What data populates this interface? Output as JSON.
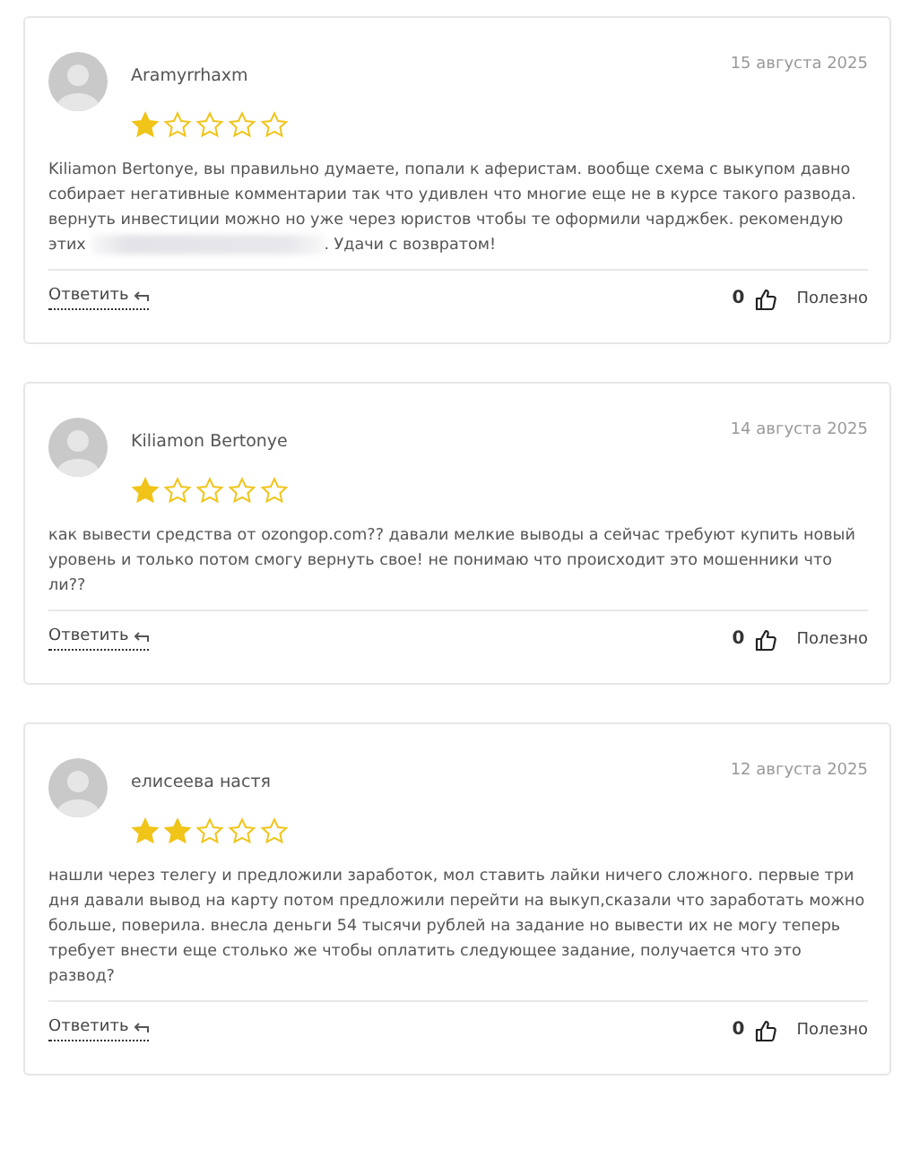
{
  "reviews": [
    {
      "author": "Aramyrrhaxm",
      "date": "15 августа 2025",
      "stars": 1,
      "text": "Kiliamon Bertonye, вы правильно думаете, попали к аферистам. вообще схема с выкупом давно собирает негативные комментарии так что удивлен что многие еще не в курсе такого развода. вернуть инвестиции можно но уже через юристов чтобы те оформили чарджбек. рекомендую этих",
      "redacted": true,
      "text_after": ". Удачи с возвратом!",
      "reply": "Ответить",
      "likes": "0",
      "helpful": "Полезно"
    },
    {
      "author": "Kiliamon Bertonye",
      "date": "14 августа 2025",
      "stars": 1,
      "text": "как вывести средства от ozongop.com?? давали мелкие выводы а сейчас требуют купить новый уровень и только потом смогу вернуть свое! не понимаю что происходит это мошенники что ли??",
      "redacted": false,
      "reply": "Ответить",
      "likes": "0",
      "helpful": "Полезно"
    },
    {
      "author": "елисеева настя",
      "date": "12 августа 2025",
      "stars": 2,
      "text": "нашли через телегу и предложили заработок, мол ставить лайки ничего сложного. первые три дня давали вывод на карту потом предложили перейти на выкуп,сказали что заработать можно больше, поверила. внесла деньги 54 тысячи рублей на задание но вывести их не могу теперь требует внести еще столько же чтобы оплатить следующее задание, получается что это развод?",
      "redacted": false,
      "reply": "Ответить",
      "likes": "0",
      "helpful": "Полезно"
    }
  ]
}
